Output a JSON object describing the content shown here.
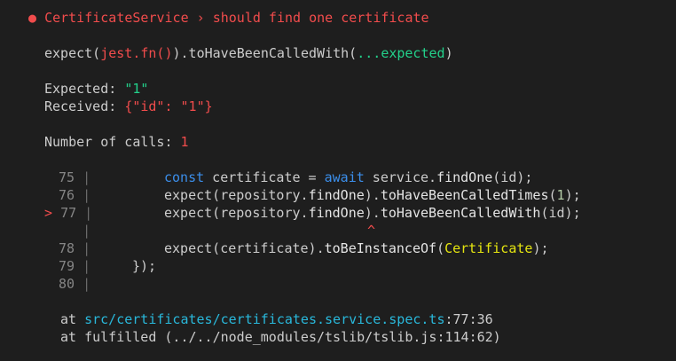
{
  "header": {
    "bullet": "●",
    "suite": "CertificateService",
    "separator": " › ",
    "test": "should find one certificate"
  },
  "matcher": {
    "prefix": "expect(",
    "received_fn": "jest.fn()",
    "middle": ").toHaveBeenCalledWith(",
    "spread": "...",
    "expected_word": "expected",
    "suffix": ")"
  },
  "diff": {
    "expected_label": "Expected: ",
    "expected_value": "\"1\"",
    "received_label": "Received: ",
    "received_value": "{\"id\": \"1\"}"
  },
  "calls": {
    "label": "Number of calls: ",
    "value": "1"
  },
  "code_frame": {
    "pointer": ">",
    "caret": "^",
    "lines": [
      {
        "num": "75",
        "kw": "const",
        "text1": " certificate = ",
        "kw2": "await",
        "text2": " service.",
        "fn": "findOne",
        "text3": "(id);"
      },
      {
        "num": "76",
        "text1": "expect(repository.",
        "fn": "findOne",
        "text2": ").",
        "fn2": "toHaveBeenCalledTimes",
        "text3": "(",
        "num_lit": "1",
        "text4": ");"
      },
      {
        "num": "77",
        "text1": "expect(repository.",
        "fn": "findOne",
        "text2": ").",
        "fn2": "toHaveBeenCalledWith",
        "text3": "(id);"
      },
      {
        "num": "78",
        "text1": "expect(certificate).",
        "fn": "toBeInstanceOf",
        "text2": "(",
        "cls": "Certificate",
        "text3": ");"
      },
      {
        "num": "79",
        "text1": "});"
      },
      {
        "num": "80",
        "text1": ""
      }
    ]
  },
  "stack": [
    {
      "prefix": "at ",
      "path": "src/certificates/certificates.service.spec.ts",
      "loc": ":77:36"
    },
    {
      "prefix": "at ",
      "path": "fulfilled (../../node_modules/tslib/tslib.js:114:62)",
      "loc": ""
    }
  ]
}
